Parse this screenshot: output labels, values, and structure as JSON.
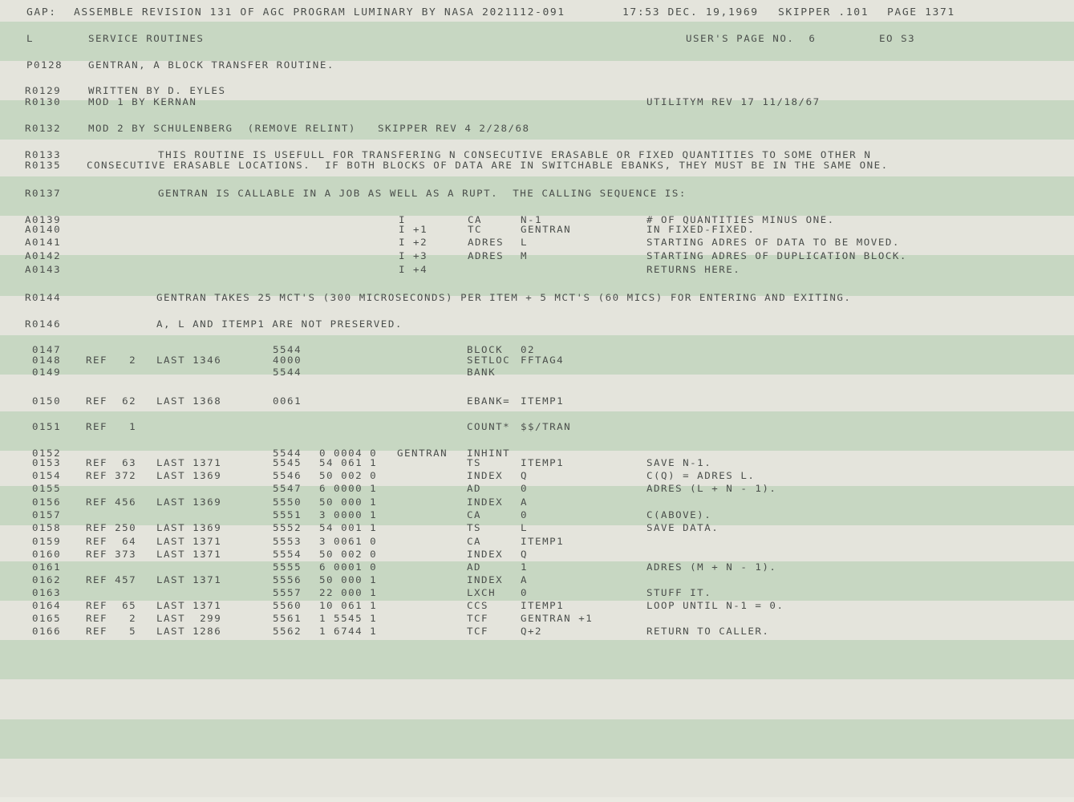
{
  "header": {
    "gap": "GAP:",
    "banner": "ASSEMBLE REVISION 131 OF AGC PROGRAM LUMINARY BY NASA 2021112-091",
    "datetime": "17:53 DEC. 19,1969",
    "skipper": "SKIPPER .101",
    "page": "PAGE 1371"
  },
  "page_info": {
    "log_section": "L",
    "section_title": "SERVICE ROUTINES",
    "users_page": "USER'S PAGE NO.  6",
    "eo": "EO S3"
  },
  "remarks": {
    "r128": {
      "num": "P0128",
      "text": "GENTRAN, A BLOCK TRANSFER ROUTINE."
    },
    "r129": {
      "num": "R0129",
      "text": "WRITTEN BY D. EYLES"
    },
    "r130": {
      "num": "R0130",
      "text": "MOD 1 BY KERNAN",
      "right": "UTILITYM REV 17 11/18/67"
    },
    "r132": {
      "num": "R0132",
      "text": "MOD 2 BY SCHULENBERG  (REMOVE RELINT)   SKIPPER REV 4 2/28/68"
    },
    "r133": {
      "num": "R0133",
      "text": "THIS ROUTINE IS USEFULL FOR TRANSFERING N CONSECUTIVE ERASABLE OR FIXED QUANTITIES TO SOME OTHER N"
    },
    "r135": {
      "num": "R0135",
      "text": "CONSECUTIVE ERASABLE LOCATIONS.  IF BOTH BLOCKS OF DATA ARE IN SWITCHABLE EBANKS, THEY MUST BE IN THE SAME ONE."
    },
    "r137": {
      "num": "R0137",
      "text": "GENTRAN IS CALLABLE IN A JOB AS WELL AS A RUPT.  THE CALLING SEQUENCE IS:"
    },
    "r144": {
      "num": "R0144",
      "text": "GENTRAN TAKES 25 MCT'S (300 MICROSECONDS) PER ITEM + 5 MCT'S (60 MICS) FOR ENTERING AND EXITING."
    },
    "r146": {
      "num": "R0146",
      "text": "A, L AND ITEMP1 ARE NOT PRESERVED."
    }
  },
  "calling_sequence": [
    {
      "num": "A0139",
      "loc": "I",
      "op": "CA",
      "arg": "N-1",
      "comment": "# OF QUANTITIES MINUS ONE."
    },
    {
      "num": "A0140",
      "loc": "I +1",
      "op": "TC",
      "arg": "GENTRAN",
      "comment": "IN FIXED-FIXED."
    },
    {
      "num": "A0141",
      "loc": "I +2",
      "op": "ADRES",
      "arg": "L",
      "comment": "STARTING ADRES OF DATA TO BE MOVED."
    },
    {
      "num": "A0142",
      "loc": "I +3",
      "op": "ADRES",
      "arg": "M",
      "comment": "STARTING ADRES OF DUPLICATION BLOCK."
    },
    {
      "num": "A0143",
      "loc": "I +4",
      "op": "",
      "arg": "",
      "comment": "RETURNS HERE."
    }
  ],
  "code": [
    {
      "num": "0147",
      "ref": "",
      "last": "",
      "addr": "5544",
      "word": "",
      "label": "",
      "op": "BLOCK",
      "arg": "02",
      "comment": ""
    },
    {
      "num": "0148",
      "ref": "REF   2",
      "last": "LAST 1346",
      "addr": "4000",
      "word": "",
      "label": "",
      "op": "SETLOC",
      "arg": "FFTAG4",
      "comment": ""
    },
    {
      "num": "0149",
      "ref": "",
      "last": "",
      "addr": "5544",
      "word": "",
      "label": "",
      "op": "BANK",
      "arg": "",
      "comment": ""
    },
    {
      "num": "0150",
      "ref": "REF  62",
      "last": "LAST 1368",
      "addr": "0061",
      "word": "",
      "label": "",
      "op": "EBANK=",
      "arg": "ITEMP1",
      "comment": ""
    },
    {
      "num": "0151",
      "ref": "REF   1",
      "last": "",
      "addr": "",
      "word": "",
      "label": "",
      "op": "COUNT*",
      "arg": "$$/TRAN",
      "comment": ""
    },
    {
      "num": "0152",
      "ref": "",
      "last": "",
      "addr": "5544",
      "word": "0 0004 0",
      "label": "GENTRAN",
      "op": "INHINT",
      "arg": "",
      "comment": ""
    },
    {
      "num": "0153",
      "ref": "REF  63",
      "last": "LAST 1371",
      "addr": "5545",
      "word": "54 061 1",
      "label": "",
      "op": "TS",
      "arg": "ITEMP1",
      "comment": "SAVE N-1."
    },
    {
      "num": "0154",
      "ref": "REF 372",
      "last": "LAST 1369",
      "addr": "5546",
      "word": "50 002 0",
      "label": "",
      "op": "INDEX",
      "arg": "Q",
      "comment": "C(Q) = ADRES L."
    },
    {
      "num": "0155",
      "ref": "",
      "last": "",
      "addr": "5547",
      "word": "6 0000 1",
      "label": "",
      "op": "AD",
      "arg": "0",
      "comment": "ADRES (L + N - 1)."
    },
    {
      "num": "0156",
      "ref": "REF 456",
      "last": "LAST 1369",
      "addr": "5550",
      "word": "50 000 1",
      "label": "",
      "op": "INDEX",
      "arg": "A",
      "comment": ""
    },
    {
      "num": "0157",
      "ref": "",
      "last": "",
      "addr": "5551",
      "word": "3 0000 1",
      "label": "",
      "op": "CA",
      "arg": "0",
      "comment": "C(ABOVE)."
    },
    {
      "num": "0158",
      "ref": "REF 250",
      "last": "LAST 1369",
      "addr": "5552",
      "word": "54 001 1",
      "label": "",
      "op": "TS",
      "arg": "L",
      "comment": "SAVE DATA."
    },
    {
      "num": "0159",
      "ref": "REF  64",
      "last": "LAST 1371",
      "addr": "5553",
      "word": "3 0061 0",
      "label": "",
      "op": "CA",
      "arg": "ITEMP1",
      "comment": ""
    },
    {
      "num": "0160",
      "ref": "REF 373",
      "last": "LAST 1371",
      "addr": "5554",
      "word": "50 002 0",
      "label": "",
      "op": "INDEX",
      "arg": "Q",
      "comment": ""
    },
    {
      "num": "0161",
      "ref": "",
      "last": "",
      "addr": "5555",
      "word": "6 0001 0",
      "label": "",
      "op": "AD",
      "arg": "1",
      "comment": "ADRES (M + N - 1)."
    },
    {
      "num": "0162",
      "ref": "REF 457",
      "last": "LAST 1371",
      "addr": "5556",
      "word": "50 000 1",
      "label": "",
      "op": "INDEX",
      "arg": "A",
      "comment": ""
    },
    {
      "num": "0163",
      "ref": "",
      "last": "",
      "addr": "5557",
      "word": "22 000 1",
      "label": "",
      "op": "LXCH",
      "arg": "0",
      "comment": "STUFF IT."
    },
    {
      "num": "0164",
      "ref": "REF  65",
      "last": "LAST 1371",
      "addr": "5560",
      "word": "10 061 1",
      "label": "",
      "op": "CCS",
      "arg": "ITEMP1",
      "comment": "LOOP UNTIL N-1 = 0."
    },
    {
      "num": "0165",
      "ref": "REF   2",
      "last": "LAST  299",
      "addr": "5561",
      "word": "1 5545 1",
      "label": "",
      "op": "TCF",
      "arg": "GENTRAN +1",
      "comment": ""
    },
    {
      "num": "0166",
      "ref": "REF   5",
      "last": "LAST 1286",
      "addr": "5562",
      "word": "1 6744 1",
      "label": "",
      "op": "TCF",
      "arg": "Q+2",
      "comment": "RETURN TO CALLER."
    }
  ]
}
